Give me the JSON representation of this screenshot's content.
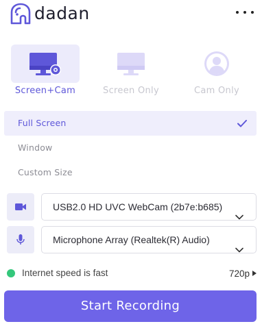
{
  "app": {
    "name": "dadan"
  },
  "modes": [
    {
      "label": "Screen+Cam",
      "icon": "monitor-with-webcam-icon",
      "active": true
    },
    {
      "label": "Screen Only",
      "icon": "monitor-icon",
      "active": false
    },
    {
      "label": "Cam Only",
      "icon": "user-avatar-icon",
      "active": false
    }
  ],
  "capture_options": [
    {
      "label": "Full Screen",
      "selected": true
    },
    {
      "label": "Window",
      "selected": false
    },
    {
      "label": "Custom Size",
      "selected": false
    }
  ],
  "camera": {
    "icon": "video-camera-icon",
    "value": "USB2.0 HD UVC WebCam (2b7e:b685)"
  },
  "microphone": {
    "icon": "microphone-icon",
    "value": "Microphone Array (Realtek(R) Audio)"
  },
  "status": {
    "text": "Internet speed is fast",
    "indicator_color": "#34c77b"
  },
  "quality": {
    "value": "720p"
  },
  "actions": {
    "start_label": "Start Recording"
  },
  "colors": {
    "accent": "#6e64e8",
    "accent_text": "#5e57d9",
    "tile_active_bg": "#ecebfb"
  }
}
